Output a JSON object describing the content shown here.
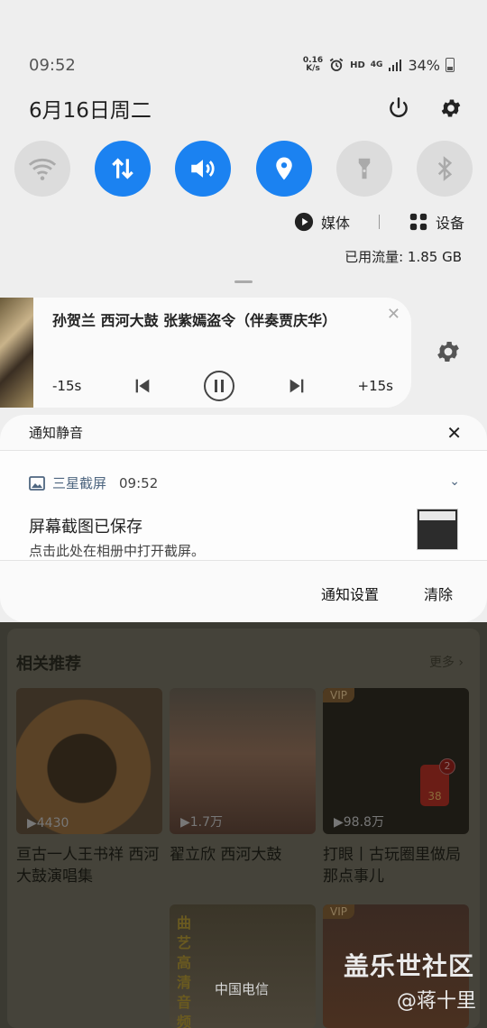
{
  "status_bar": {
    "time": "09:52",
    "net_speed_value": "0.16",
    "net_speed_unit": "K/s",
    "hd_label": "HD",
    "network_label": "4G",
    "battery": "34%"
  },
  "header": {
    "date": "6月16日周二"
  },
  "quick_toggles": [
    {
      "name": "wifi",
      "state": "off"
    },
    {
      "name": "mobile-data",
      "state": "on"
    },
    {
      "name": "sound",
      "state": "on"
    },
    {
      "name": "location",
      "state": "on"
    },
    {
      "name": "flashlight",
      "state": "off"
    },
    {
      "name": "bluetooth",
      "state": "off"
    }
  ],
  "media_device": {
    "media_label": "媒体",
    "device_label": "设备"
  },
  "data_usage": "已用流量: 1.85 GB",
  "media_player": {
    "title": "孙贺兰 西河大鼓 张紫嫣盗令（伴奏贾庆华）",
    "rewind_label": "-15s",
    "forward_label": "+15s"
  },
  "silent_notifications": {
    "header": "通知静音",
    "app_name": "三星截屏",
    "time": "09:52",
    "title": "屏幕截图已保存",
    "subtitle": "点击此处在相册中打开截屏。",
    "settings_label": "通知设置",
    "clear_label": "清除"
  },
  "background_app": {
    "section_title": "相关推荐",
    "more_label": "更多",
    "items": [
      {
        "count": "▶4430",
        "caption": "亘古一人王书祥 西河大鼓演唱集"
      },
      {
        "count": "▶1.7万",
        "caption": "翟立欣 西河大鼓"
      },
      {
        "count": "▶98.8万",
        "caption": "打眼丨古玩圈里做局那点事儿",
        "vip": "VIP",
        "redpack_badge": "2",
        "redpack_num": "38"
      }
    ],
    "second_row": [
      {
        "vip": "",
        "art_text": "曲艺高清音频"
      },
      {
        "vip": "VIP"
      }
    ]
  },
  "carrier": "中国电信",
  "watermark": "盖乐世社区",
  "watermark_author": "@蒋十里",
  "colors": {
    "accent": "#1b82f1",
    "shade_bg": "#eeeeee",
    "card_bg": "#fafafa"
  }
}
